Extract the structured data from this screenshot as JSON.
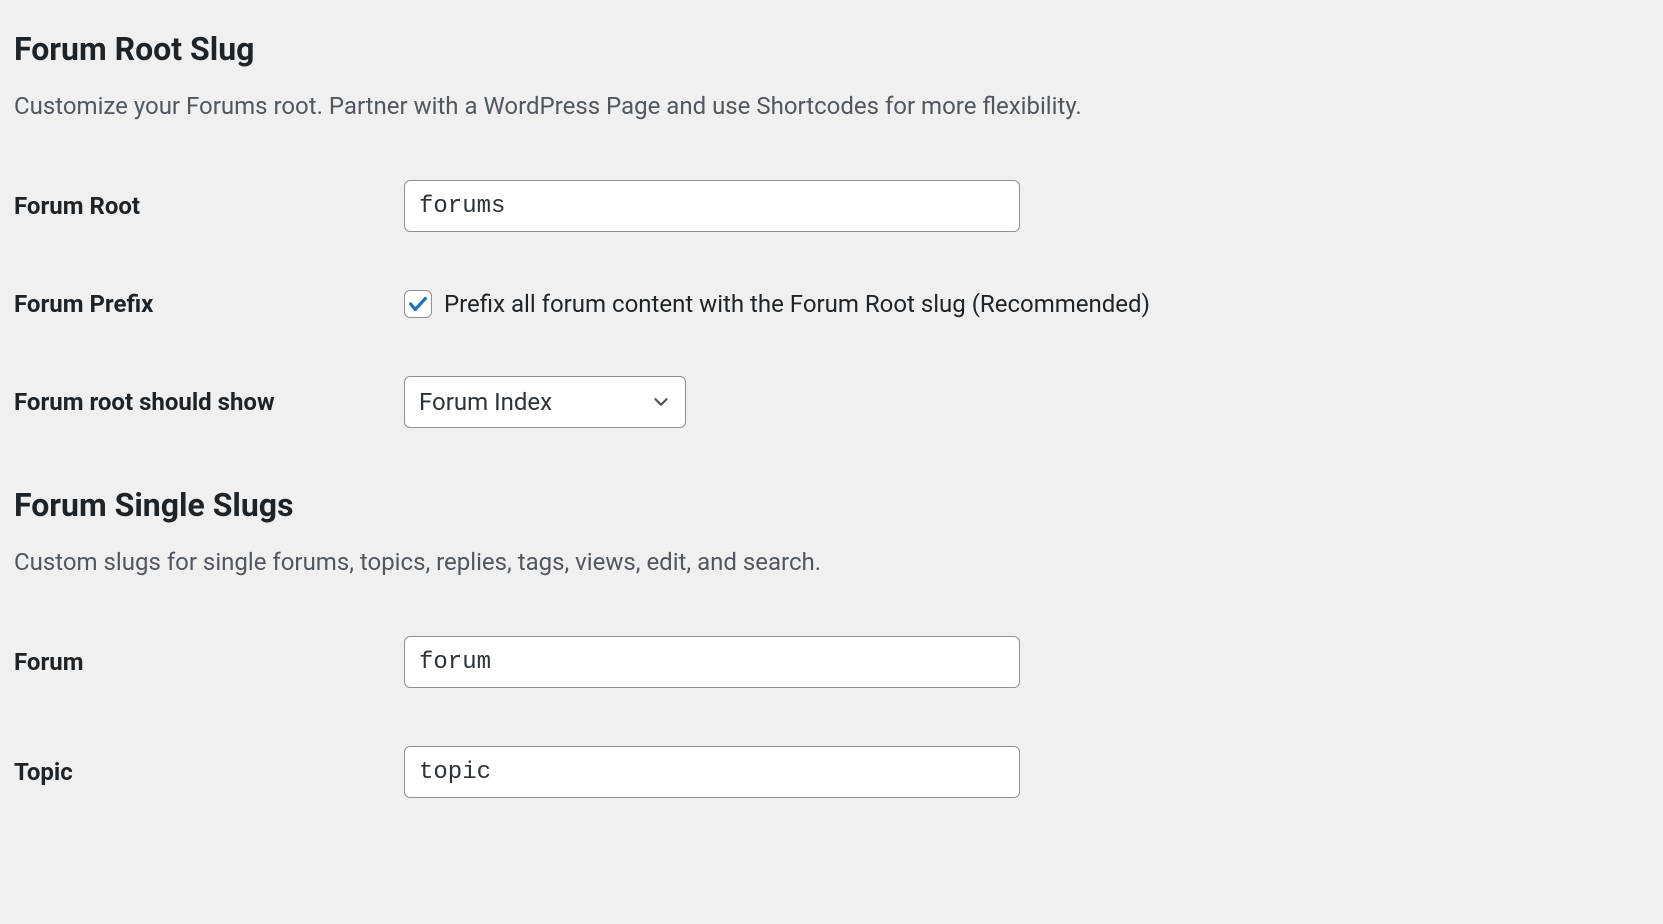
{
  "sections": {
    "root": {
      "heading": "Forum Root Slug",
      "description": "Customize your Forums root. Partner with a WordPress Page and use Shortcodes for more flexibility.",
      "fields": {
        "forum_root": {
          "label": "Forum Root",
          "value": "forums"
        },
        "forum_prefix": {
          "label": "Forum Prefix",
          "checkbox_label": "Prefix all forum content with the Forum Root slug (Recommended)",
          "checked": true
        },
        "root_show": {
          "label": "Forum root should show",
          "selected": "Forum Index"
        }
      }
    },
    "single": {
      "heading": "Forum Single Slugs",
      "description": "Custom slugs for single forums, topics, replies, tags, views, edit, and search.",
      "fields": {
        "forum": {
          "label": "Forum",
          "value": "forum"
        },
        "topic": {
          "label": "Topic",
          "value": "topic"
        }
      }
    }
  }
}
